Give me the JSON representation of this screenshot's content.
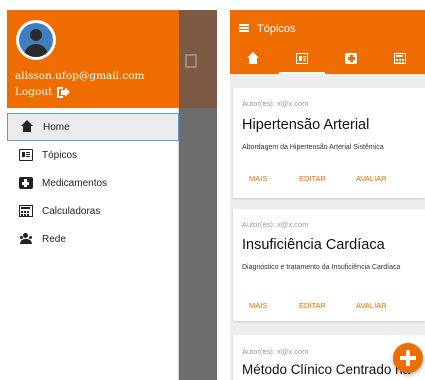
{
  "drawer": {
    "user_email": "alisson.ufop@gmail.com",
    "logout_label": "Logout",
    "items": [
      {
        "label": "Home",
        "icon": "home-icon",
        "active": true
      },
      {
        "label": "Tópicos",
        "icon": "topics-icon"
      },
      {
        "label": "Medicamentos",
        "icon": "medical-kit-icon"
      },
      {
        "label": "Calculadoras",
        "icon": "calculator-icon"
      },
      {
        "label": "Rede",
        "icon": "users-icon"
      }
    ]
  },
  "appbar": {
    "title": "Tópicos",
    "tabs": [
      {
        "icon": "home-icon"
      },
      {
        "icon": "topics-icon",
        "active": true
      },
      {
        "icon": "medical-kit-icon"
      },
      {
        "icon": "calculator-icon"
      }
    ]
  },
  "cards": [
    {
      "author": "Autor(es): x@x.com",
      "title": "Hipertensão Arterial",
      "description": "Abordagem da Hipertensão Arterial Sistêmica",
      "actions": [
        "MAIS",
        "EDITAR",
        "AVALIAR"
      ]
    },
    {
      "author": "Autor(es): x@x.com",
      "title": "Insuficiência Cardíaca",
      "description": "Diagnóstico e tratamento da Insuficiência Cardíaca",
      "actions": [
        "MAIS",
        "EDITAR",
        "AVALIAR"
      ]
    },
    {
      "author": "Autor(es): x@x.com",
      "title": "Método Clínico Centrado na"
    }
  ],
  "colors": {
    "primary": "#ef6c00",
    "background": "#eeeeee",
    "active_border": "#5f9bd3"
  }
}
